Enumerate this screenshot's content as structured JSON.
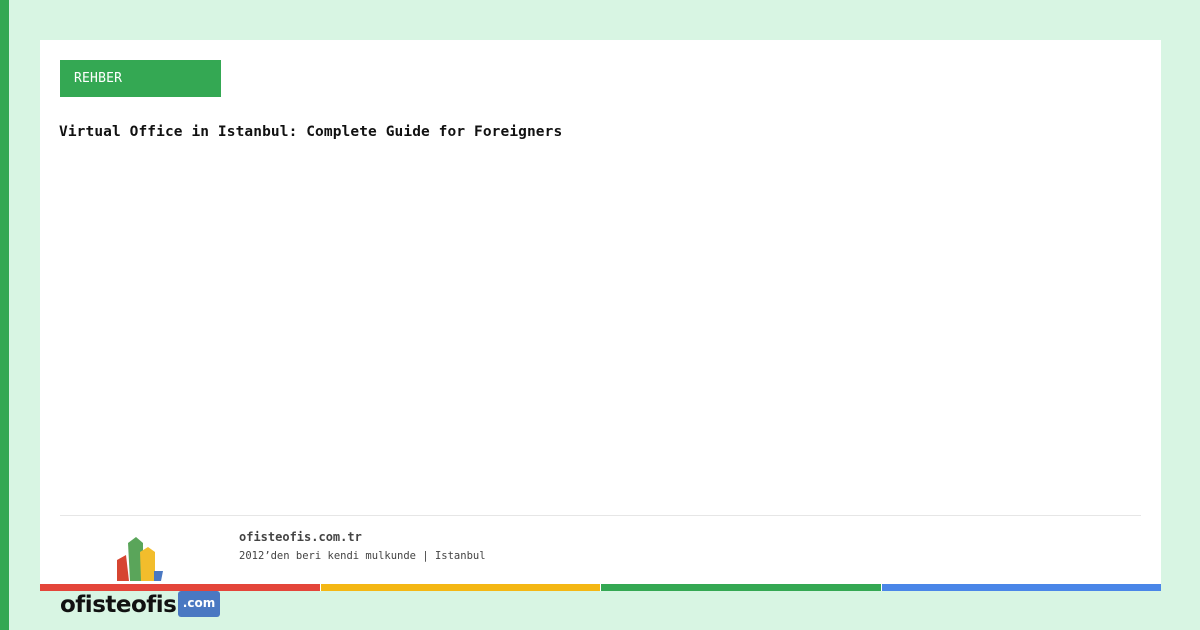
{
  "card": {
    "tag": "REHBER",
    "headline": "Virtual Office in Istanbul: Complete Guide for Foreigners"
  },
  "footer": {
    "site_name": "ofisteofis.com.tr",
    "tagline": "2012’den beri kendi mulkunde | Istanbul"
  },
  "logo": {
    "text": "ofisteofis",
    "suffix": ".com"
  },
  "colors": {
    "background": "#d8f5e3",
    "accent": "#34a853",
    "bar": [
      "#e4453a",
      "#f4b714",
      "#34a853",
      "#4a86e8"
    ],
    "logo_suffix_bg": "#4a78c2"
  }
}
